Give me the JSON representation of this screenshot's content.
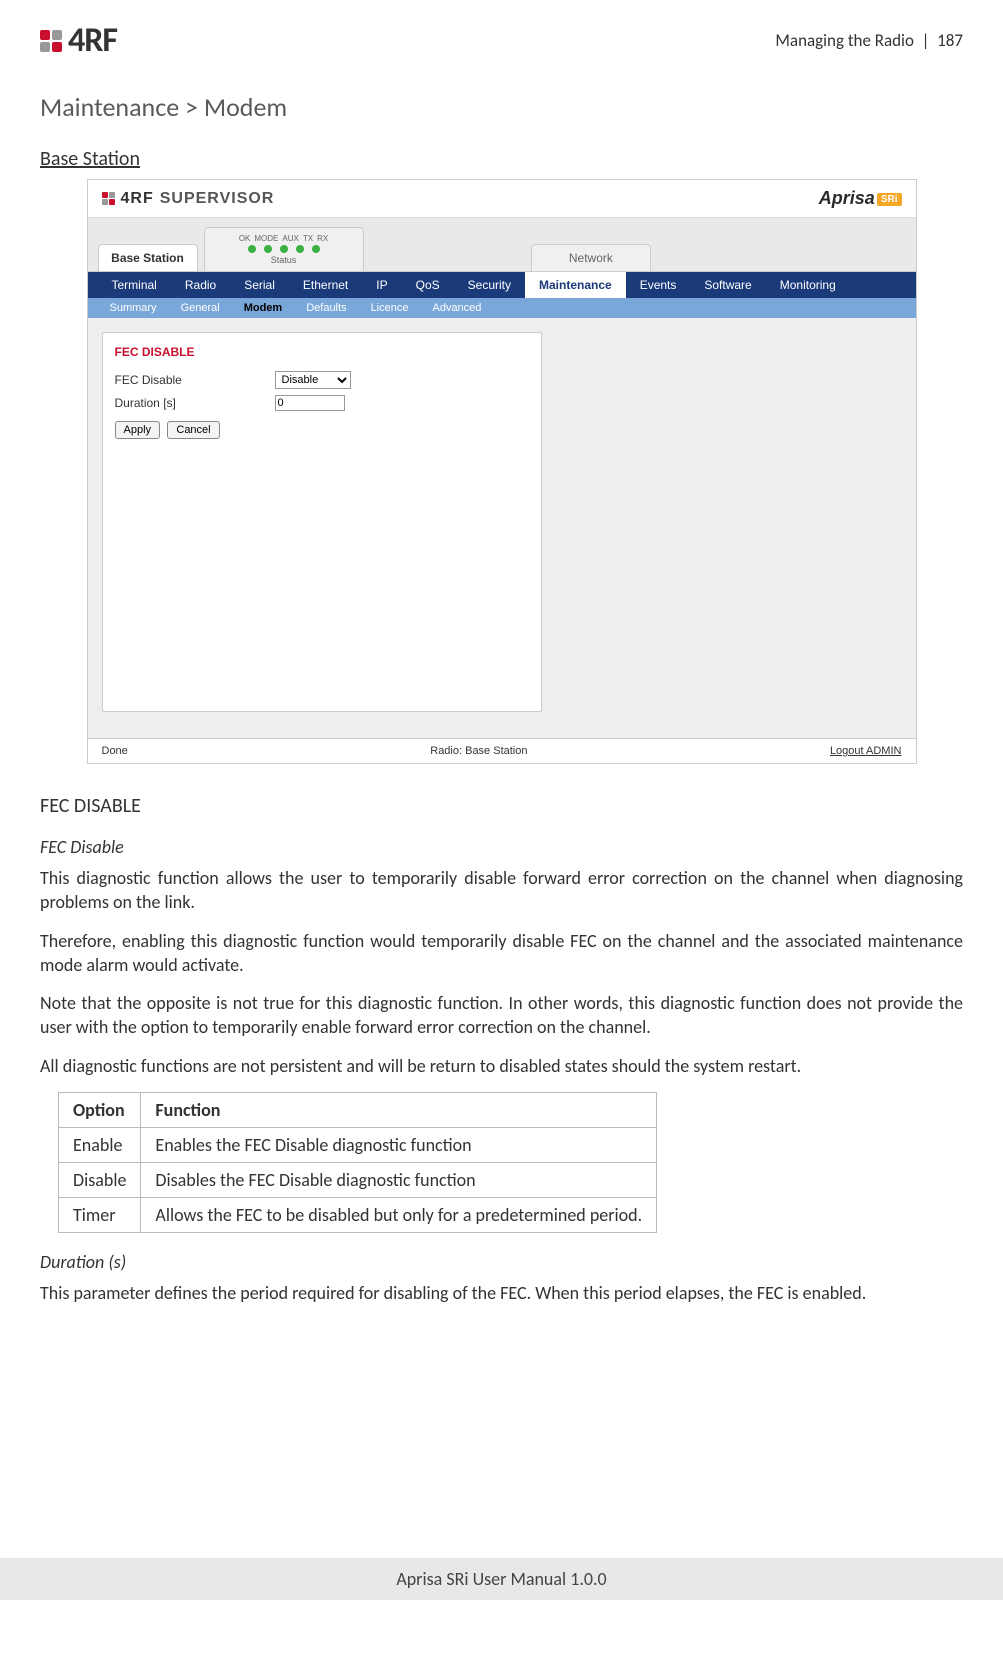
{
  "header": {
    "section": "Managing the Radio",
    "page_no": "187",
    "brand": "4RF"
  },
  "breadcrumb": "Maintenance > Modem",
  "section_heading": "Base Station",
  "screenshot": {
    "supervisor_label": "SUPERVISOR",
    "supervisor_brand": "4RF",
    "aprisa_label": "Aprisa",
    "aprisa_tag": "SRi",
    "tab_base": "Base Station",
    "led_labels": [
      "OK",
      "MODE",
      "AUX",
      "TX",
      "RX"
    ],
    "status_label": "Status",
    "tab_network": "Network",
    "nav1": [
      "Terminal",
      "Radio",
      "Serial",
      "Ethernet",
      "IP",
      "QoS",
      "Security",
      "Maintenance",
      "Events",
      "Software",
      "Monitoring"
    ],
    "nav1_active": "Maintenance",
    "nav2": [
      "Summary",
      "General",
      "Modem",
      "Defaults",
      "Licence",
      "Advanced"
    ],
    "nav2_active": "Modem",
    "panel_title": "FEC DISABLE",
    "field_fec_label": "FEC Disable",
    "field_fec_value": "Disable",
    "field_dur_label": "Duration [s]",
    "field_dur_value": "0",
    "btn_apply": "Apply",
    "btn_cancel": "Cancel",
    "foot_left": "Done",
    "foot_center": "Radio: Base Station",
    "foot_right": "Logout ADMIN"
  },
  "doc": {
    "h_fec_disable": "FEC DISABLE",
    "h_fec_disable_sub": "FEC Disable",
    "p1": "This diagnostic function allows the user to temporarily disable forward error correction on the channel when diagnosing problems on the link.",
    "p2": "Therefore, enabling this diagnostic function would temporarily disable FEC on the channel and the associated maintenance mode alarm would activate.",
    "p3": "Note that the opposite is not true for this diagnostic function.  In other words, this diagnostic function does not provide the user with the option to temporarily enable forward error correction on the channel.",
    "p4": "All diagnostic functions are not persistent and will be return to disabled states should the system restart.",
    "table": {
      "h_option": "Option",
      "h_function": "Function",
      "rows": [
        {
          "opt": "Enable",
          "fn": "Enables the FEC Disable diagnostic function"
        },
        {
          "opt": "Disable",
          "fn": "Disables the FEC Disable diagnostic function"
        },
        {
          "opt": "Timer",
          "fn": "Allows the FEC to be disabled but only for a predetermined period."
        }
      ]
    },
    "h_duration": "Duration (s)",
    "p_duration": "This parameter defines the period required for disabling of the FEC. When this period elapses, the FEC is enabled."
  },
  "footer": "Aprisa SRi User Manual 1.0.0"
}
